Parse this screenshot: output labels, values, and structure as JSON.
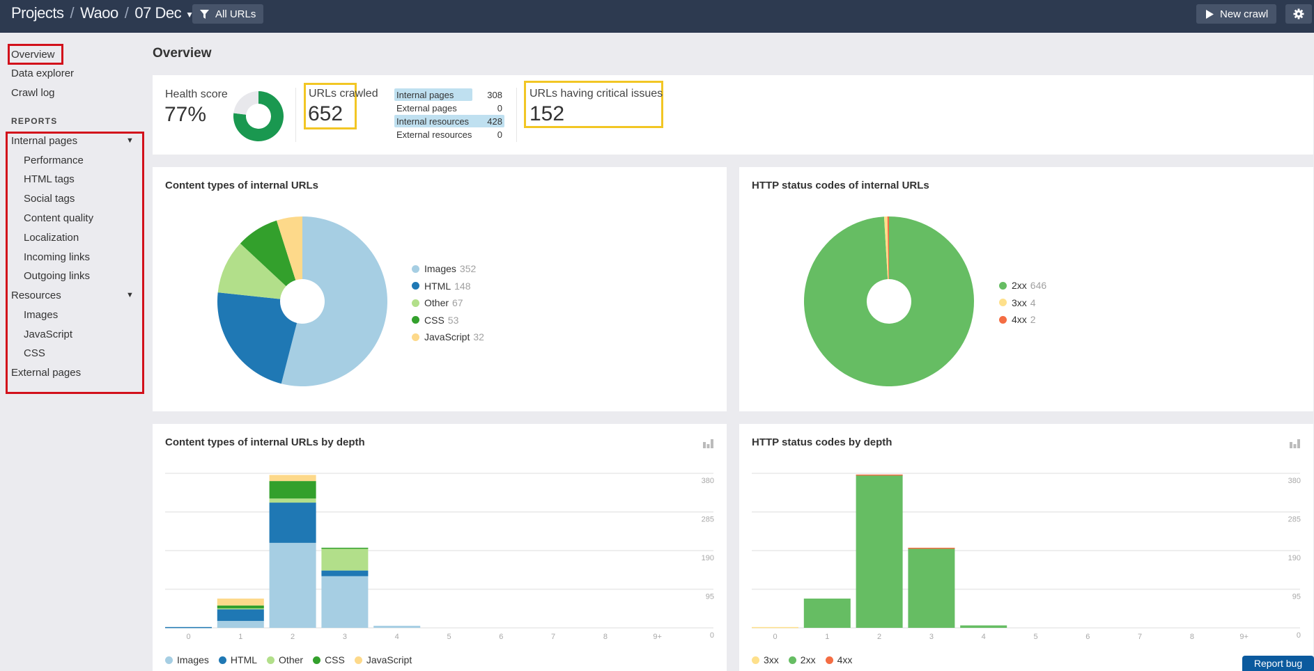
{
  "topbar": {
    "breadcrumb": [
      "Projects",
      "Waoo",
      "07 Dec"
    ],
    "filter_label": "All URLs",
    "new_crawl_label": "New crawl",
    "icons": {
      "filter": "filter-icon",
      "play": "play-icon",
      "settings": "gear-icon",
      "dropdown": "caret-down-icon"
    }
  },
  "sidebar": {
    "top_items": [
      {
        "label": "Overview",
        "active": true
      },
      {
        "label": "Data explorer"
      },
      {
        "label": "Crawl log"
      }
    ],
    "reports_label": "REPORTS",
    "groups": [
      {
        "label": "Internal pages",
        "expanded": true,
        "items": [
          "Performance",
          "HTML tags",
          "Social tags",
          "Content quality",
          "Localization",
          "Incoming links",
          "Outgoing links"
        ]
      },
      {
        "label": "Resources",
        "expanded": true,
        "items": [
          "Images",
          "JavaScript",
          "CSS"
        ]
      },
      {
        "label": "External pages",
        "expanded": false,
        "items": []
      }
    ]
  },
  "page": {
    "title": "Overview"
  },
  "summary": {
    "health_score_label": "Health score",
    "health_score_value": "77%",
    "health_score_fraction": 0.77,
    "urls_crawled_label": "URLs crawled",
    "urls_crawled_value": "652",
    "breakdown": [
      {
        "label": "Internal pages",
        "value": "308",
        "highlighted": true
      },
      {
        "label": "External pages",
        "value": "0",
        "highlighted": false
      },
      {
        "label": "Internal resources",
        "value": "428",
        "highlighted": true
      },
      {
        "label": "External resources",
        "value": "0",
        "highlighted": false
      }
    ],
    "critical_label": "URLs having critical issues",
    "critical_value": "152"
  },
  "colors": {
    "Images": "#a6cee3",
    "HTML": "#1f78b4",
    "Other": "#b2df8a",
    "CSS": "#33a02c",
    "JavaScript": "#fdd98a",
    "2xx": "#66bd63",
    "3xx": "#fee08b",
    "4xx": "#f46d43",
    "health": "#1a9850",
    "health_rest": "#e8e8ec"
  },
  "report_bug_label": "Report bug",
  "chart_data": [
    {
      "type": "pie",
      "title": "Content types of internal URLs",
      "donut": true,
      "legend_position": "right",
      "slices": [
        {
          "label": "Images",
          "value": 352
        },
        {
          "label": "HTML",
          "value": 148
        },
        {
          "label": "Other",
          "value": 67
        },
        {
          "label": "CSS",
          "value": 53
        },
        {
          "label": "JavaScript",
          "value": 32
        }
      ]
    },
    {
      "type": "pie",
      "title": "HTTP status codes of internal URLs",
      "donut": true,
      "legend_position": "right",
      "slices": [
        {
          "label": "2xx",
          "value": 646
        },
        {
          "label": "3xx",
          "value": 4
        },
        {
          "label": "4xx",
          "value": 2
        }
      ]
    },
    {
      "type": "bar",
      "stacked": true,
      "title": "Content types of internal URLs by depth",
      "categories": [
        "0",
        "1",
        "2",
        "3",
        "4",
        "5",
        "6",
        "7",
        "8",
        "9+"
      ],
      "ylim": [
        0,
        380
      ],
      "yticks": [
        "0",
        "95",
        "190",
        "285",
        "380"
      ],
      "grid": true,
      "legend_position": "bottom",
      "series": [
        {
          "name": "Images",
          "values": [
            0,
            17,
            209,
            127,
            5,
            0,
            0,
            0,
            0,
            0
          ]
        },
        {
          "name": "HTML",
          "values": [
            2,
            29,
            99,
            14,
            0,
            0,
            0,
            0,
            0,
            0
          ]
        },
        {
          "name": "Other",
          "values": [
            0,
            2,
            10,
            54,
            0,
            0,
            0,
            0,
            0,
            0
          ]
        },
        {
          "name": "CSS",
          "values": [
            0,
            7,
            43,
            2,
            0,
            0,
            0,
            0,
            0,
            0
          ]
        },
        {
          "name": "JavaScript",
          "values": [
            0,
            17,
            15,
            0,
            0,
            0,
            0,
            0,
            0,
            0
          ]
        }
      ]
    },
    {
      "type": "bar",
      "stacked": true,
      "title": "HTTP status codes by depth",
      "categories": [
        "0",
        "1",
        "2",
        "3",
        "4",
        "5",
        "6",
        "7",
        "8",
        "9+"
      ],
      "ylim": [
        0,
        380
      ],
      "yticks": [
        "0",
        "95",
        "190",
        "285",
        "380"
      ],
      "grid": true,
      "legend_position": "bottom",
      "series": [
        {
          "name": "3xx",
          "values": [
            2,
            0,
            0,
            0,
            0,
            0,
            0,
            0,
            0,
            0
          ]
        },
        {
          "name": "2xx",
          "values": [
            0,
            72,
            376,
            196,
            6,
            0,
            0,
            0,
            0,
            0
          ]
        },
        {
          "name": "4xx",
          "values": [
            0,
            0,
            1,
            1,
            0,
            0,
            0,
            0,
            0,
            0
          ]
        }
      ]
    }
  ]
}
